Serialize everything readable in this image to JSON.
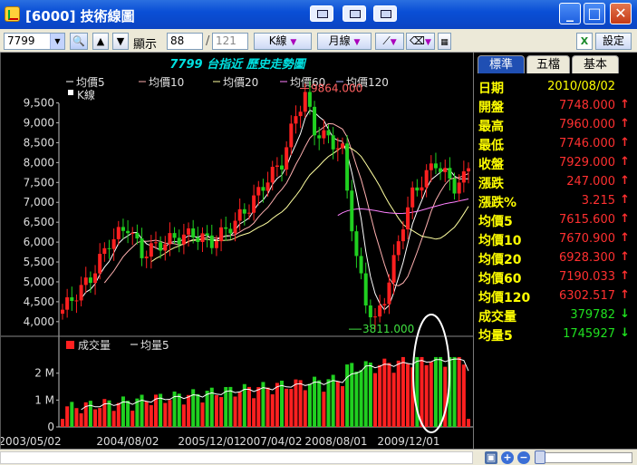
{
  "window": {
    "title": "[6000] 技術線圖"
  },
  "toolbar": {
    "stock_code": "7799",
    "display_label": "顯示",
    "display_count": "88",
    "display_total": "121",
    "chart_type_label": "K線",
    "period_label": "月線",
    "settings_label": "設定"
  },
  "chart_data": [
    {
      "type": "candlestick",
      "title": "7799 台指近  歷史走勢圖",
      "legend": [
        "均價5",
        "均價10",
        "均價20",
        "均價60",
        "均價120",
        "K線"
      ],
      "ylim": [
        3700,
        9900
      ],
      "yticks": [
        "9,500",
        "9,000",
        "8,500",
        "8,000",
        "7,500",
        "7,000",
        "6,500",
        "6,000",
        "5,500",
        "5,000",
        "4,500",
        "4,000"
      ],
      "xticks": [
        "2003/05/02",
        "2004/08/02",
        "2005/12/01",
        "2007/04/02",
        "2008/08/01",
        "2009/12/01"
      ],
      "annotations": [
        {
          "text": "9864.000",
          "value": 9864
        },
        {
          "text": "3811.000",
          "value": 3811
        }
      ],
      "series": [
        {
          "name": "均價5",
          "color": "#ffffff"
        },
        {
          "name": "均價10",
          "color": "#ffb0b0"
        },
        {
          "name": "均價20",
          "color": "#ffffa0"
        },
        {
          "name": "均價60",
          "color": "#ff80ff"
        },
        {
          "name": "均價120",
          "color": "#b0b0ff"
        }
      ]
    },
    {
      "type": "bar",
      "legend": [
        "成交量",
        "均量5"
      ],
      "yticks": [
        "2 M",
        "1 M",
        "0"
      ]
    }
  ],
  "panel": {
    "tabs": [
      "標準",
      "五檔",
      "基本"
    ],
    "rows": [
      {
        "k": "日期",
        "v": "2010/08/02",
        "dir": ""
      },
      {
        "k": "開盤",
        "v": "7748.000",
        "dir": "up"
      },
      {
        "k": "最高",
        "v": "7960.000",
        "dir": "up"
      },
      {
        "k": "最低",
        "v": "7746.000",
        "dir": "up"
      },
      {
        "k": "收盤",
        "v": "7929.000",
        "dir": "up"
      },
      {
        "k": "漲跌",
        "v": "247.000",
        "dir": "up"
      },
      {
        "k": "漲跌%",
        "v": "3.215",
        "dir": "up"
      },
      {
        "k": "均價5",
        "v": "7615.600",
        "dir": "up"
      },
      {
        "k": "均價10",
        "v": "7670.900",
        "dir": "up"
      },
      {
        "k": "均價20",
        "v": "6928.300",
        "dir": "up"
      },
      {
        "k": "均價60",
        "v": "7190.033",
        "dir": "up"
      },
      {
        "k": "均價120",
        "v": "6302.517",
        "dir": "up"
      },
      {
        "k": "成交量",
        "v": "379782",
        "dir": "down"
      },
      {
        "k": "均量5",
        "v": "1745927",
        "dir": "down"
      }
    ]
  },
  "icons": [
    "app-icon",
    "search-icon",
    "up-arrow-icon",
    "down-arrow-icon",
    "excel-icon",
    "line-tool-icon",
    "eraser-icon",
    "grid-icon",
    "zoom-in-icon",
    "zoom-out-icon"
  ]
}
